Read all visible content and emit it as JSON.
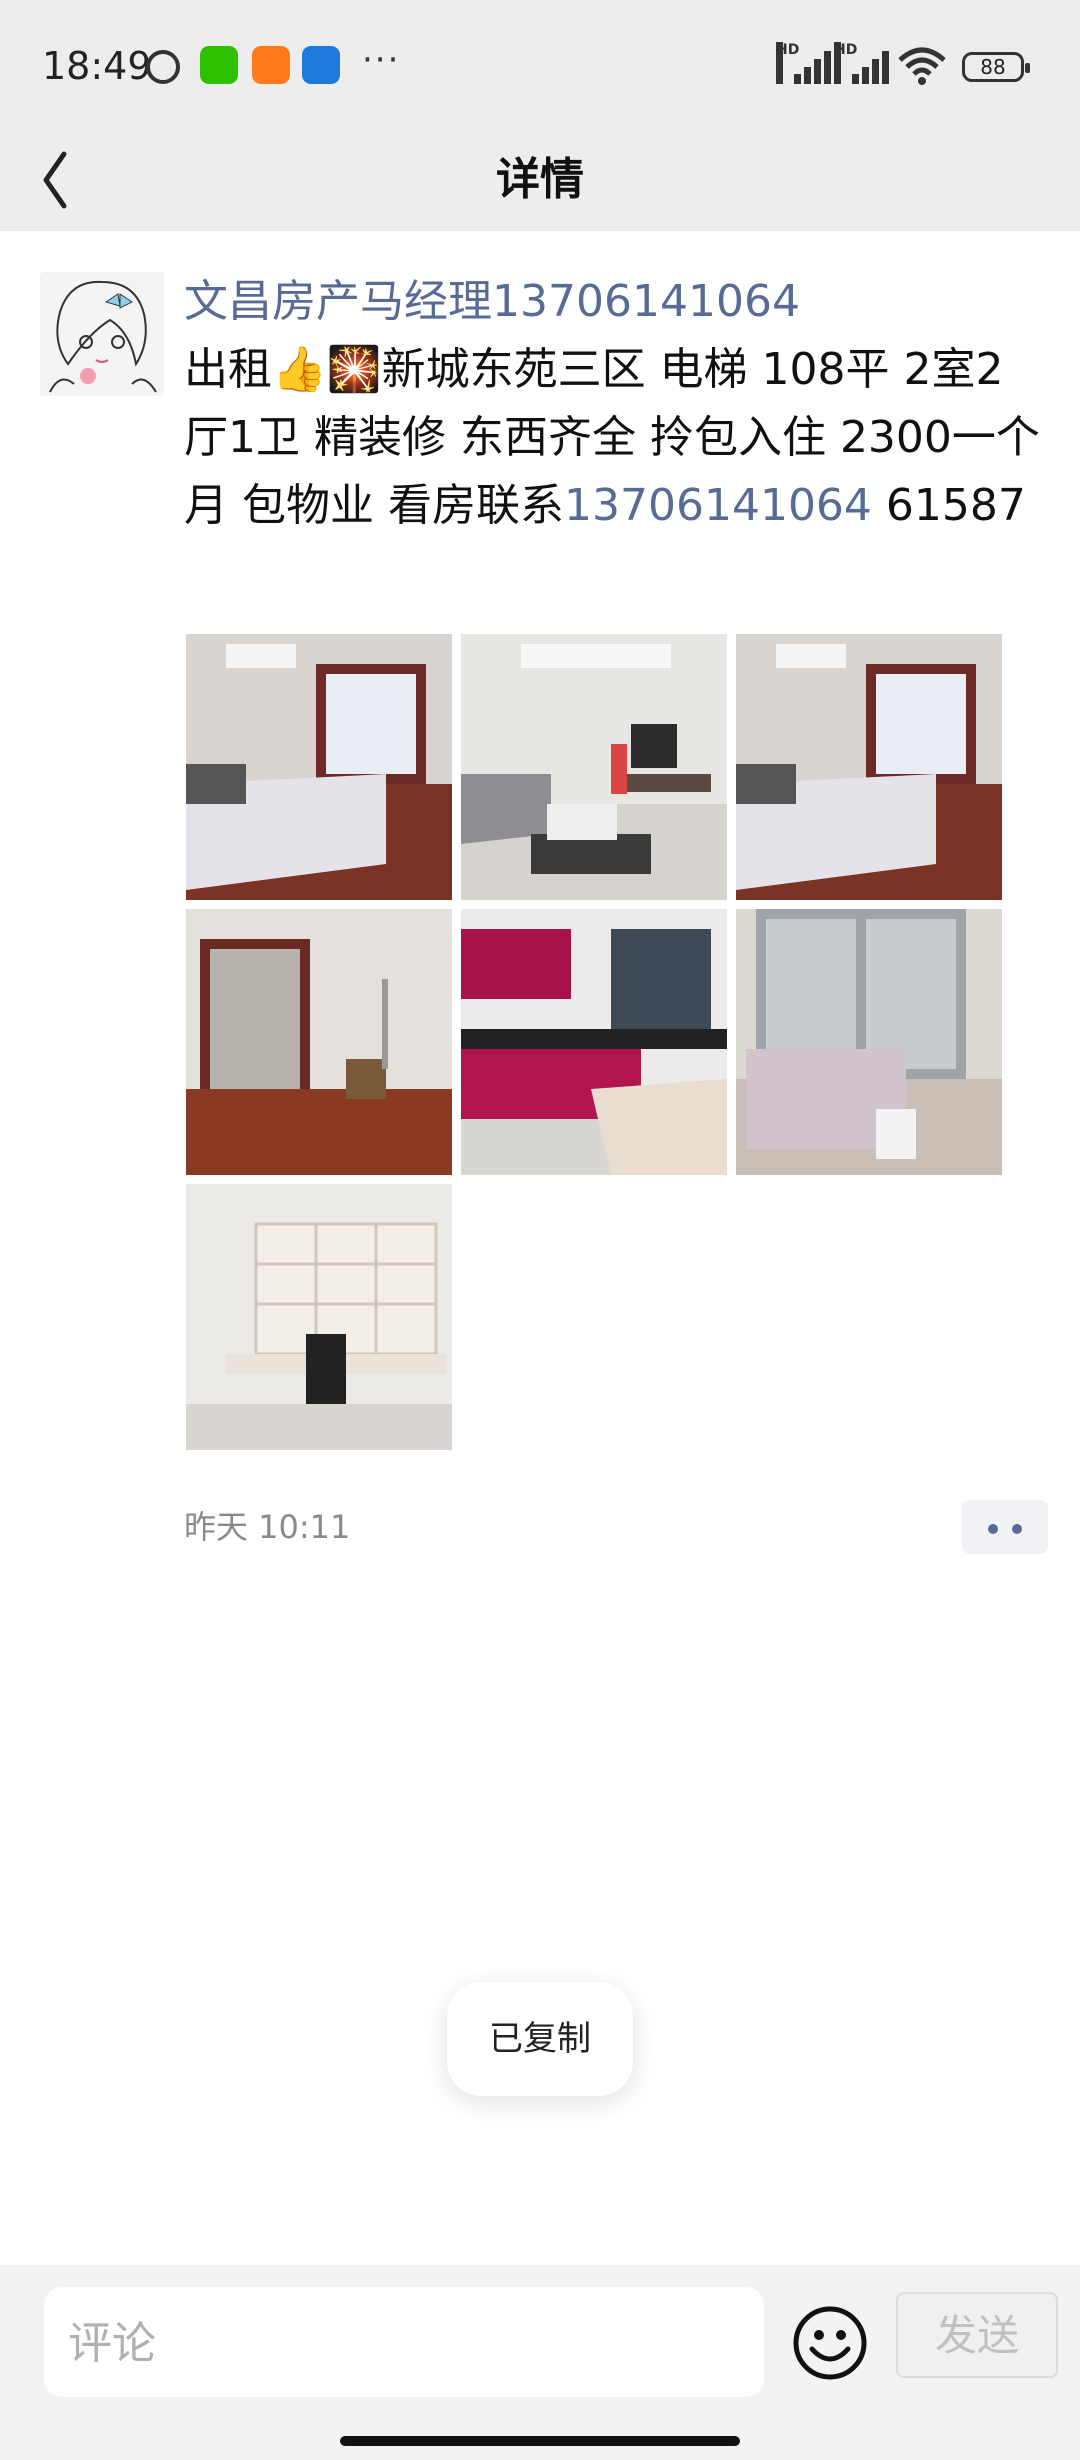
{
  "status_bar": {
    "time": "18:49",
    "battery": "88",
    "more": "···"
  },
  "header": {
    "title": "详情"
  },
  "post": {
    "author": "文昌房产马经理13706141064",
    "text_before_link": "出租👍🎇新城东苑三区 电梯  108平  2室2厅1卫 精装修  东西齐全 拎包入住  2300一个月  包物业  看房联系",
    "phone_link": "13706141064",
    "text_after_link": " 61587",
    "timestamp": "昨天 10:11",
    "photos": [
      {
        "name": "bedroom-photo"
      },
      {
        "name": "living-room-photo"
      },
      {
        "name": "bedroom-photo-2"
      },
      {
        "name": "hall-photo"
      },
      {
        "name": "kitchen-photo"
      },
      {
        "name": "balcony-photo"
      },
      {
        "name": "study-photo"
      }
    ]
  },
  "toast": {
    "text": "已复制"
  },
  "comment_bar": {
    "placeholder": "评论",
    "send_label": "发送"
  },
  "colors": {
    "link": "#576b95",
    "background_top": "#ededed"
  }
}
